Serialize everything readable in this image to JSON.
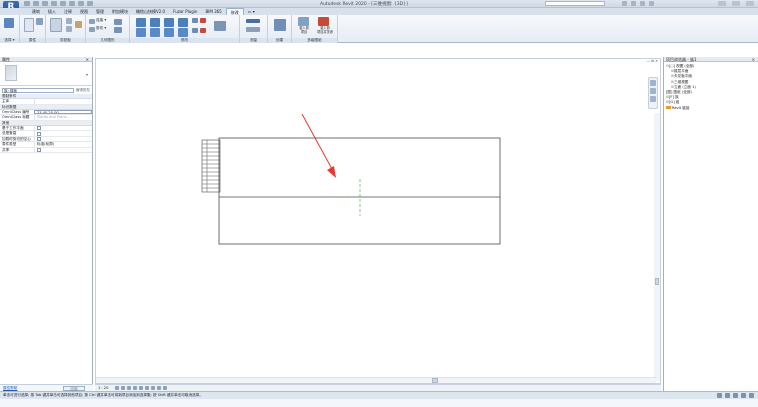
{
  "app": {
    "button_label": "R"
  },
  "title_bar": {
    "title": "Autodesk Revit 2020 - [三维视图: {3D}]"
  },
  "ribbon": {
    "tabs": [
      "建筑",
      "插入",
      "注释",
      "视图",
      "管理",
      "附加模块",
      "橄榄山快模V2.0",
      "Fuzor Plugin",
      "BIM 365",
      "修改",
      "▭ ▾"
    ],
    "active_tab_index": 9,
    "panels": [
      {
        "label": "选择 ▾"
      },
      {
        "label": "属性"
      },
      {
        "label": "剪贴板"
      },
      {
        "label": "几何图形"
      },
      {
        "label": "修改"
      },
      {
        "label": "测量"
      },
      {
        "label": "创建"
      },
      {
        "label": "多级图纸"
      }
    ],
    "tool_labels": [
      "连接 ▾",
      "剪切 ▾",
      "载入到\n项目",
      "载入到\n项目并关闭"
    ]
  },
  "properties": {
    "title": "属性",
    "close": "×",
    "selector_value": "族: 楼板",
    "edit_type": "编辑类型",
    "sections": [
      {
        "title": "限制条件",
        "rows": [
          {
            "key": "主体",
            "value": ""
          }
        ]
      },
      {
        "title": "标识数据",
        "rows": [
          {
            "key": "OmniClass 编号",
            "value": "23.40.25.00",
            "input": true
          },
          {
            "key": "OmniClass 标题",
            "value": "Plants and Plant...",
            "grey": true
          }
        ]
      },
      {
        "title": "其他",
        "rows": [
          {
            "key": "基于工作平面",
            "value": "",
            "checkbox": true
          },
          {
            "key": "总是垂直",
            "value": "",
            "checkbox": true
          },
          {
            "key": "加载时剪切的空心",
            "value": "",
            "checkbox": true
          },
          {
            "key": "零件类型",
            "value": "标准(轮廓)",
            "checkbox": false
          },
          {
            "key": "共享",
            "value": "",
            "checkbox": true
          }
        ]
      }
    ],
    "help_link": "属性帮助",
    "apply_button": "应用"
  },
  "view_controls": {
    "scale": "1 : 20"
  },
  "project_browser": {
    "title": "项目浏览器 - 族1",
    "close": "×",
    "tree": [
      {
        "indent": 0,
        "exp": "⊟",
        "label": "[○] 视图 (全部)"
      },
      {
        "indent": 1,
        "exp": "⊞",
        "label": "楼层平面"
      },
      {
        "indent": 1,
        "exp": "⊞",
        "label": "天花板平面"
      },
      {
        "indent": 1,
        "exp": "⊞",
        "label": "三维视图"
      },
      {
        "indent": 1,
        "exp": "⊞",
        "label": "立面 (立面 1)"
      },
      {
        "indent": 0,
        "exp": "",
        "label": "[图] 图纸 (全部)"
      },
      {
        "indent": 0,
        "exp": "⊞",
        "label": "[F] 族"
      },
      {
        "indent": 0,
        "exp": "⊞",
        "label": "[G] 组"
      },
      {
        "indent": 0,
        "exp": "",
        "label": "Revit 链接",
        "link": true
      }
    ]
  },
  "status_bar": {
    "text": "单击可进行选择; 按 Tab 键并单击可选择其他项目; 按 Ctrl 键并单击可将新项目添加到选择集; 按 Shift 键并单击可取消选择。",
    "filter_count": ":0"
  }
}
